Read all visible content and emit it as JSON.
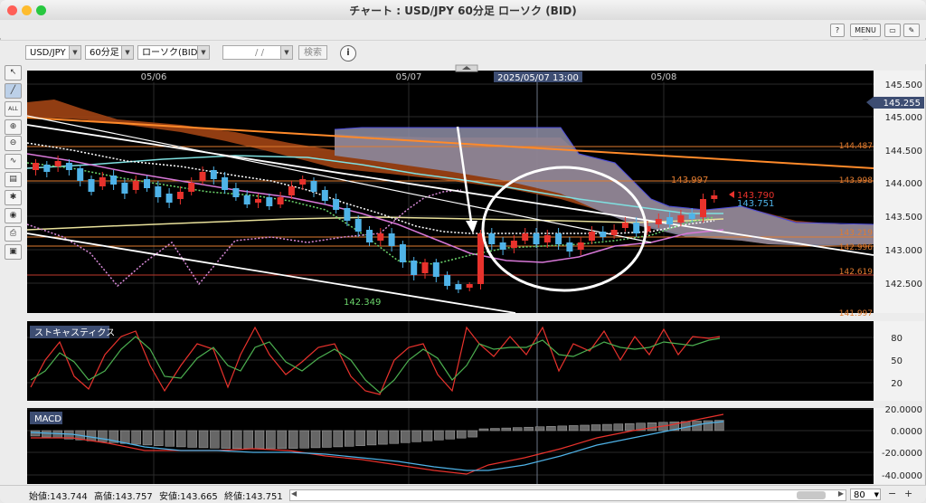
{
  "window": {
    "title": "チャート : USD/JPY 60分足 ローソク (BID)"
  },
  "toolbar_top": {
    "help_label": "?",
    "menu_label": "MENU ▼"
  },
  "toolbar": {
    "pair": "USD/JPY",
    "timeframe": "60分足",
    "chart_type": "ローソク(BID)",
    "date_value": "/ /",
    "search_label": "検索",
    "info_label": "i"
  },
  "main_chart": {
    "date_labels": [
      "05/06",
      "05/07",
      "05/08"
    ],
    "crosshair_time": "2025/05/07 13:00",
    "price_ticks": [
      "145.500",
      "145.000",
      "144.500",
      "144.000",
      "143.500",
      "143.000",
      "142.500",
      "141.997"
    ],
    "current_price": "145.255",
    "line_labels": [
      "144.487",
      "143.998",
      "143.219",
      "142.996",
      "142.619"
    ],
    "annotations": {
      "high": "143.997",
      "low": "142.349",
      "red_value": "143.790",
      "blue_value": "143.751"
    }
  },
  "stochastic": {
    "title": "ストキャスティクス",
    "ticks": [
      "80",
      "50",
      "20"
    ]
  },
  "macd": {
    "title": "MACD",
    "ticks": [
      "20.0000",
      "0.0000",
      "-20.0000",
      "-40.0000"
    ]
  },
  "status": {
    "open": "始値:143.744",
    "high": "高値:143.757",
    "low": "安値:143.665",
    "close": "終値:143.751",
    "zoom": "80"
  },
  "colors": {
    "bull": "#e8322c",
    "bear": "#4fb3e8",
    "cloud": "#8a8aa0",
    "bg": "#000000"
  },
  "icons": [
    "cursor-icon",
    "pen-icon",
    "zoom-in-icon",
    "zoom-out-icon",
    "indicator-icon",
    "eye-icon",
    "print-icon",
    "settings-icon"
  ]
}
